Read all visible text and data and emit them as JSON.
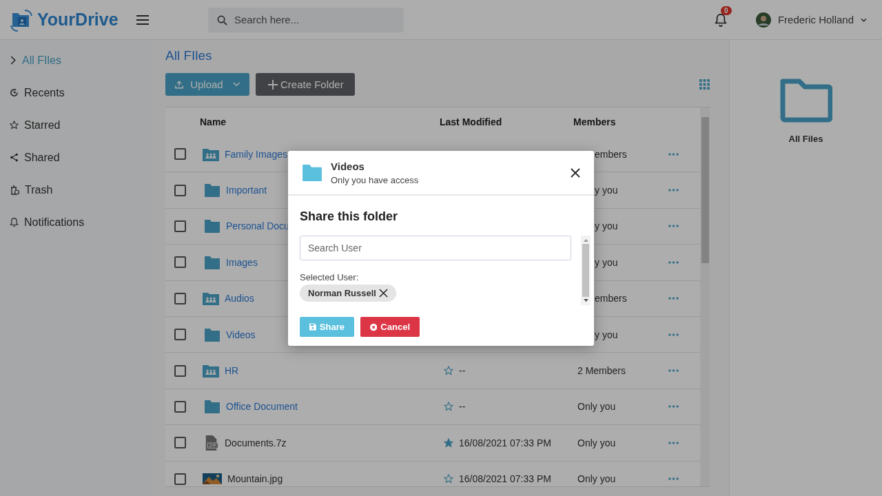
{
  "header": {
    "logo": "YourDrive",
    "search": {
      "placeholder": "Search here..."
    },
    "notifications": {
      "count": "0"
    },
    "user": {
      "name": "Frederic Holland"
    }
  },
  "sidebar": {
    "items": [
      {
        "label": "All FIles",
        "kind": "chevron",
        "selected": true
      },
      {
        "label": "Recents",
        "kind": "recent",
        "selected": false
      },
      {
        "label": "Starred",
        "kind": "star",
        "selected": false
      },
      {
        "label": "Shared",
        "kind": "share",
        "selected": false
      },
      {
        "label": "Trash",
        "kind": "trash",
        "selected": false
      },
      {
        "label": "Notifications",
        "kind": "bell",
        "selected": false
      }
    ]
  },
  "main": {
    "title": "All FIles",
    "upload": "Upload",
    "create_folder": "Create Folder"
  },
  "table": {
    "columns": [
      "Name",
      "Last Modified",
      "Members"
    ],
    "rows": [
      {
        "kind": "shared-folder",
        "name": "Family Images",
        "checked": false,
        "members": "embers"
      },
      {
        "kind": "folder",
        "name": "Important",
        "checked": false,
        "members": "y you"
      },
      {
        "kind": "folder",
        "name": "Personal Docu",
        "checked": false,
        "members": "y you"
      },
      {
        "kind": "folder",
        "name": "Images",
        "checked": false,
        "members": "y you"
      },
      {
        "kind": "shared-folder",
        "name": "Audios",
        "checked": false,
        "members": "embers"
      },
      {
        "kind": "folder",
        "name": "Videos",
        "checked": false,
        "members": "y you"
      },
      {
        "kind": "shared-folder",
        "name": "HR",
        "checked": false,
        "starred": false,
        "modified": "--",
        "members": "2 Members"
      },
      {
        "kind": "folder",
        "name": "Office Document",
        "checked": false,
        "starred": false,
        "modified": "--",
        "members": "Only you"
      },
      {
        "kind": "zip",
        "name": "Documents.7z",
        "checked": false,
        "starred": true,
        "modified": "16/08/2021 07:33 PM",
        "members": "Only you"
      },
      {
        "name": "Mountain.jpg",
        "checked": false,
        "starred": false,
        "modified": "16/08/2021 07:33 PM",
        "members": "Only you"
      }
    ]
  },
  "details": {
    "title": "All Files"
  },
  "modal": {
    "title": "Videos",
    "subtitle": "Only you have access",
    "heading": "Share this folder",
    "search": {
      "placeholder": "Search User"
    },
    "selected_label": "Selected User:",
    "selected_users": [
      {
        "name": "Norman Russell"
      }
    ],
    "share": "Share",
    "cancel": "Cancel"
  }
}
